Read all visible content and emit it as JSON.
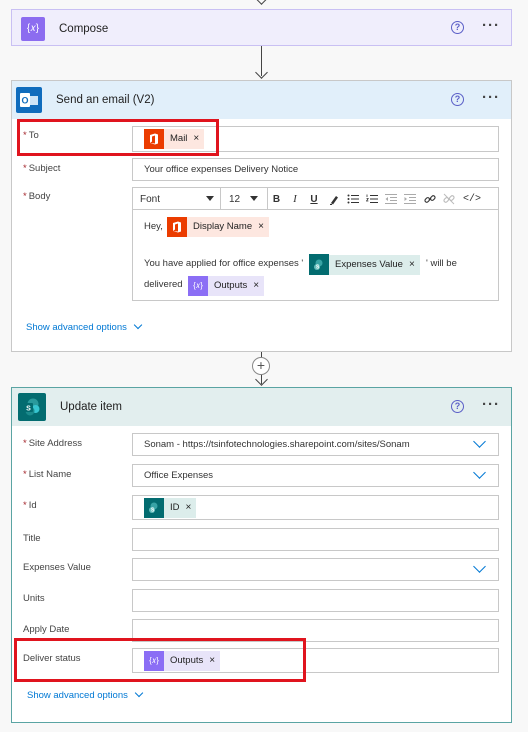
{
  "compose": {
    "title": "Compose",
    "icon": "braces-icon",
    "color": "#8c6cf0"
  },
  "email": {
    "title": "Send an email (V2)",
    "icon": "outlook-icon",
    "header_color": "#e1effa",
    "to_label": "To",
    "to_token": "Mail",
    "subject_label": "Subject",
    "subject_value": "Your office expenses Delivery Notice",
    "body_label": "Body",
    "toolbar": {
      "font": "Font",
      "size": "12",
      "bold": "B",
      "italic": "I",
      "underline": "U"
    },
    "body_greeting": "Hey,",
    "body_token_name": "Display Name",
    "body_line2_prefix": "You have applied for office expenses '",
    "body_token_expenses": "Expenses Value",
    "body_line2_suffix": "' will be",
    "body_line3_prefix": "delivered",
    "body_token_outputs": "Outputs",
    "advanced": "Show advanced options"
  },
  "add_step": {
    "symbol": "+"
  },
  "update": {
    "title": "Update item",
    "icon": "sharepoint-icon",
    "header_color": "#e2eeee",
    "site_label": "Site Address",
    "site_value": "Sonam - https://tsinfotechnologies.sharepoint.com/sites/Sonam",
    "list_label": "List Name",
    "list_value": "Office Expenses",
    "id_label": "Id",
    "id_token": "ID",
    "title_label": "Title",
    "expenses_label": "Expenses Value",
    "units_label": "Units",
    "apply_label": "Apply Date",
    "deliver_label": "Deliver status",
    "deliver_token": "Outputs",
    "advanced": "Show advanced options"
  },
  "common": {
    "help": "?",
    "more": "···",
    "required_mark": "*",
    "remove": "×"
  },
  "colors": {
    "highlight": "#e0141e",
    "link": "#0078d4",
    "accent": "#5b5fc7"
  }
}
